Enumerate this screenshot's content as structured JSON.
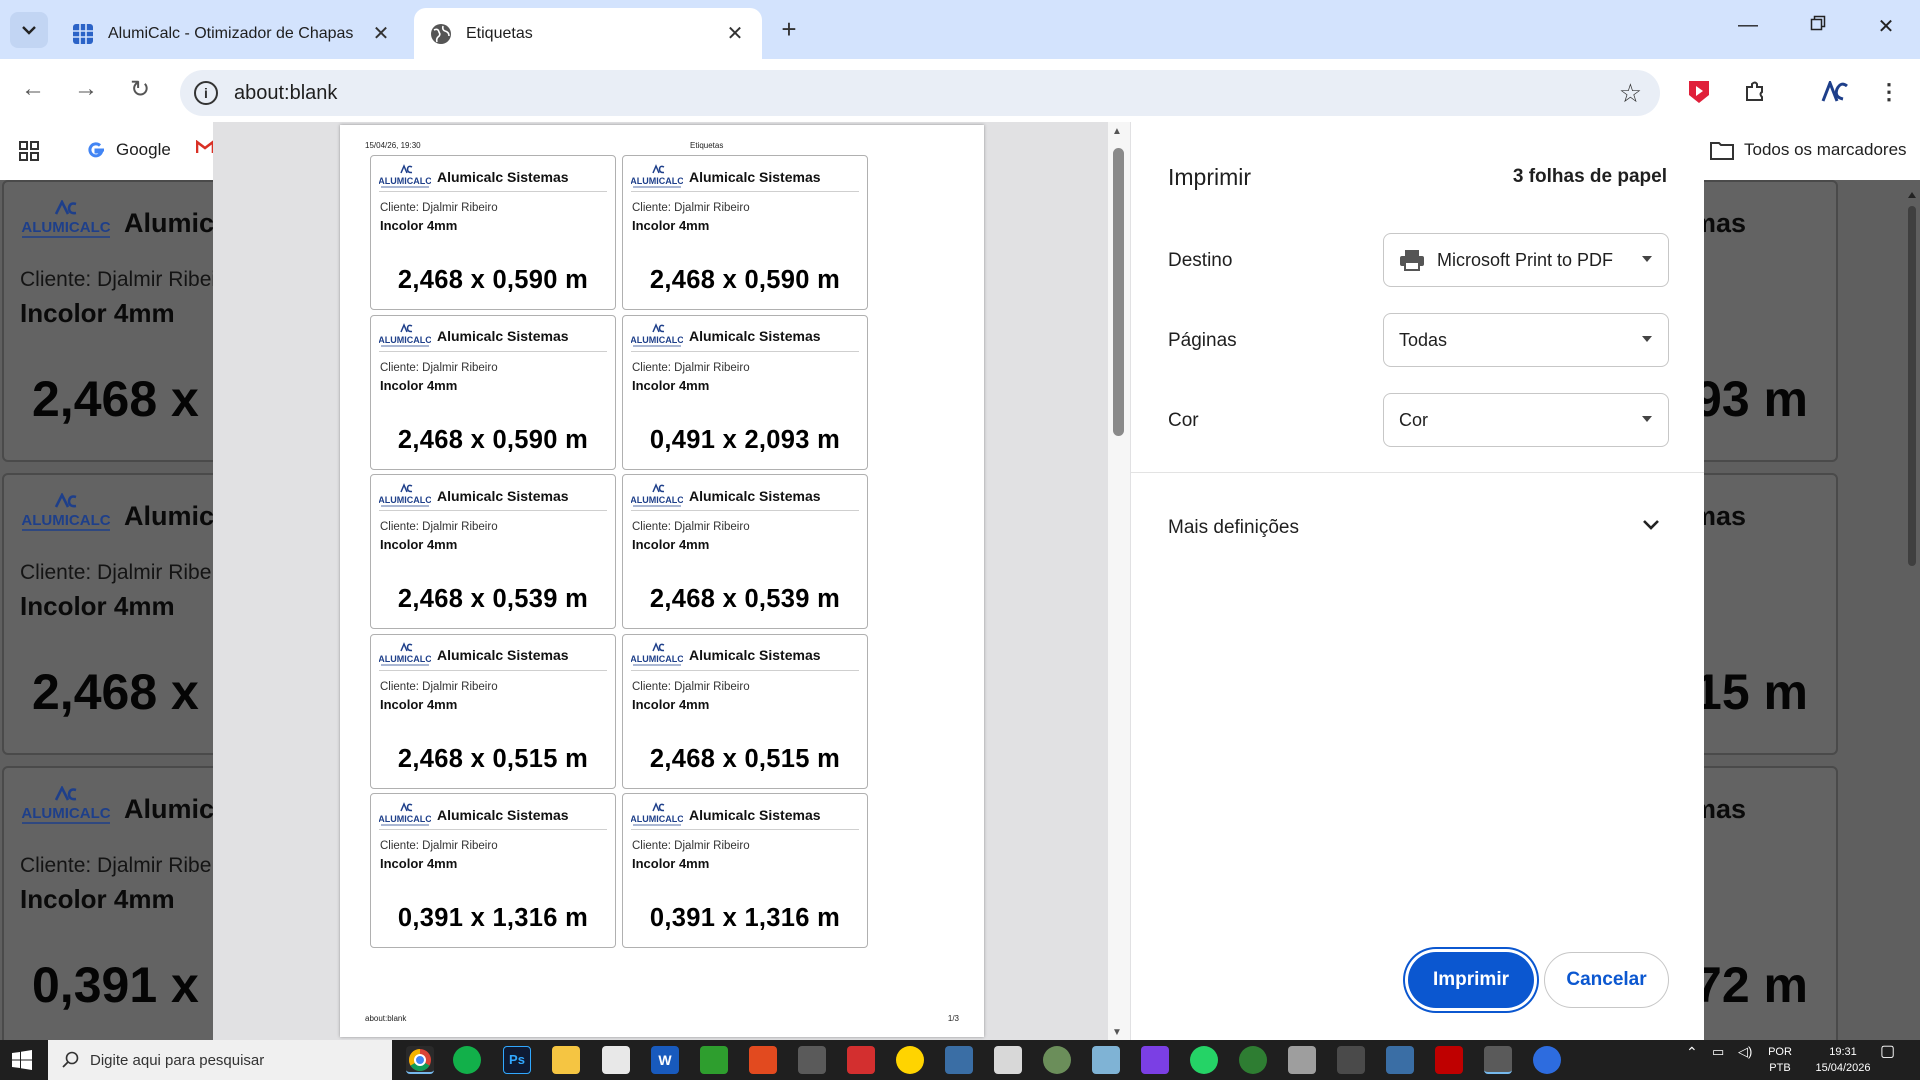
{
  "browser": {
    "tabs": [
      {
        "title": "AlumiCalc - Otimizador de Chapas",
        "active": false
      },
      {
        "title": "Etiquetas",
        "active": true
      }
    ],
    "url": "about:blank",
    "bookmarks": {
      "google": "Google",
      "all": "Todos os marcadores"
    }
  },
  "background_page": {
    "company": "Alumicalc Sistemas",
    "cards": [
      {
        "company_visible": "Alumica",
        "company_right": "mas",
        "client": "Cliente: Djalmir Ribeir",
        "material": "Incolor 4mm",
        "dim_left": "2,468 x",
        "dim_right": "93 m"
      },
      {
        "company_visible": "Alumica",
        "company_right": "mas",
        "client": "Cliente: Djalmir Ribe",
        "material": "Incolor 4mm",
        "dim_left": "2,468 x",
        "dim_right": "15 m"
      },
      {
        "company_visible": "Alumica",
        "company_right": "mas",
        "client": "Cliente: Djalmir Ribe",
        "material": "Incolor 4mm",
        "dim_left": "0,391 x",
        "dim_right": "72 m"
      }
    ]
  },
  "preview": {
    "header_date": "15/04/26, 19:30",
    "header_title": "Etiquetas",
    "footer_url": "about:blank",
    "footer_page": "1/3",
    "labels": [
      {
        "company": "Alumicalc Sistemas",
        "client": "Cliente: Djalmir Ribeiro",
        "material": "Incolor 4mm",
        "dims": "2,468 x 0,590 m"
      },
      {
        "company": "Alumicalc Sistemas",
        "client": "Cliente: Djalmir Ribeiro",
        "material": "Incolor 4mm",
        "dims": "2,468 x 0,590 m"
      },
      {
        "company": "Alumicalc Sistemas",
        "client": "Cliente: Djalmir Ribeiro",
        "material": "Incolor 4mm",
        "dims": "2,468 x 0,590 m"
      },
      {
        "company": "Alumicalc Sistemas",
        "client": "Cliente: Djalmir Ribeiro",
        "material": "Incolor 4mm",
        "dims": "0,491 x 2,093 m"
      },
      {
        "company": "Alumicalc Sistemas",
        "client": "Cliente: Djalmir Ribeiro",
        "material": "Incolor 4mm",
        "dims": "2,468 x 0,539 m"
      },
      {
        "company": "Alumicalc Sistemas",
        "client": "Cliente: Djalmir Ribeiro",
        "material": "Incolor 4mm",
        "dims": "2,468 x 0,539 m"
      },
      {
        "company": "Alumicalc Sistemas",
        "client": "Cliente: Djalmir Ribeiro",
        "material": "Incolor 4mm",
        "dims": "2,468 x 0,515 m"
      },
      {
        "company": "Alumicalc Sistemas",
        "client": "Cliente: Djalmir Ribeiro",
        "material": "Incolor 4mm",
        "dims": "2,468 x 0,515 m"
      },
      {
        "company": "Alumicalc Sistemas",
        "client": "Cliente: Djalmir Ribeiro",
        "material": "Incolor 4mm",
        "dims": "0,391 x 1,316 m"
      },
      {
        "company": "Alumicalc Sistemas",
        "client": "Cliente: Djalmir Ribeiro",
        "material": "Incolor 4mm",
        "dims": "0,391 x 1,316 m"
      }
    ]
  },
  "print_dialog": {
    "title": "Imprimir",
    "sheets": "3 folhas de papel",
    "destination_label": "Destino",
    "destination_value": "Microsoft Print to PDF",
    "pages_label": "Páginas",
    "pages_value": "Todas",
    "color_label": "Cor",
    "color_value": "Cor",
    "more_settings": "Mais definições",
    "print_button": "Imprimir",
    "cancel_button": "Cancelar"
  },
  "taskbar": {
    "search_placeholder": "Digite aqui para pesquisar",
    "lang_top": "POR",
    "lang_bottom": "PTB",
    "time": "19:31",
    "date": "15/04/2026"
  },
  "colors": {
    "accent": "#0b57d0",
    "tabbar": "#d3e3fd",
    "logo_blue": "#1e3f8a"
  }
}
